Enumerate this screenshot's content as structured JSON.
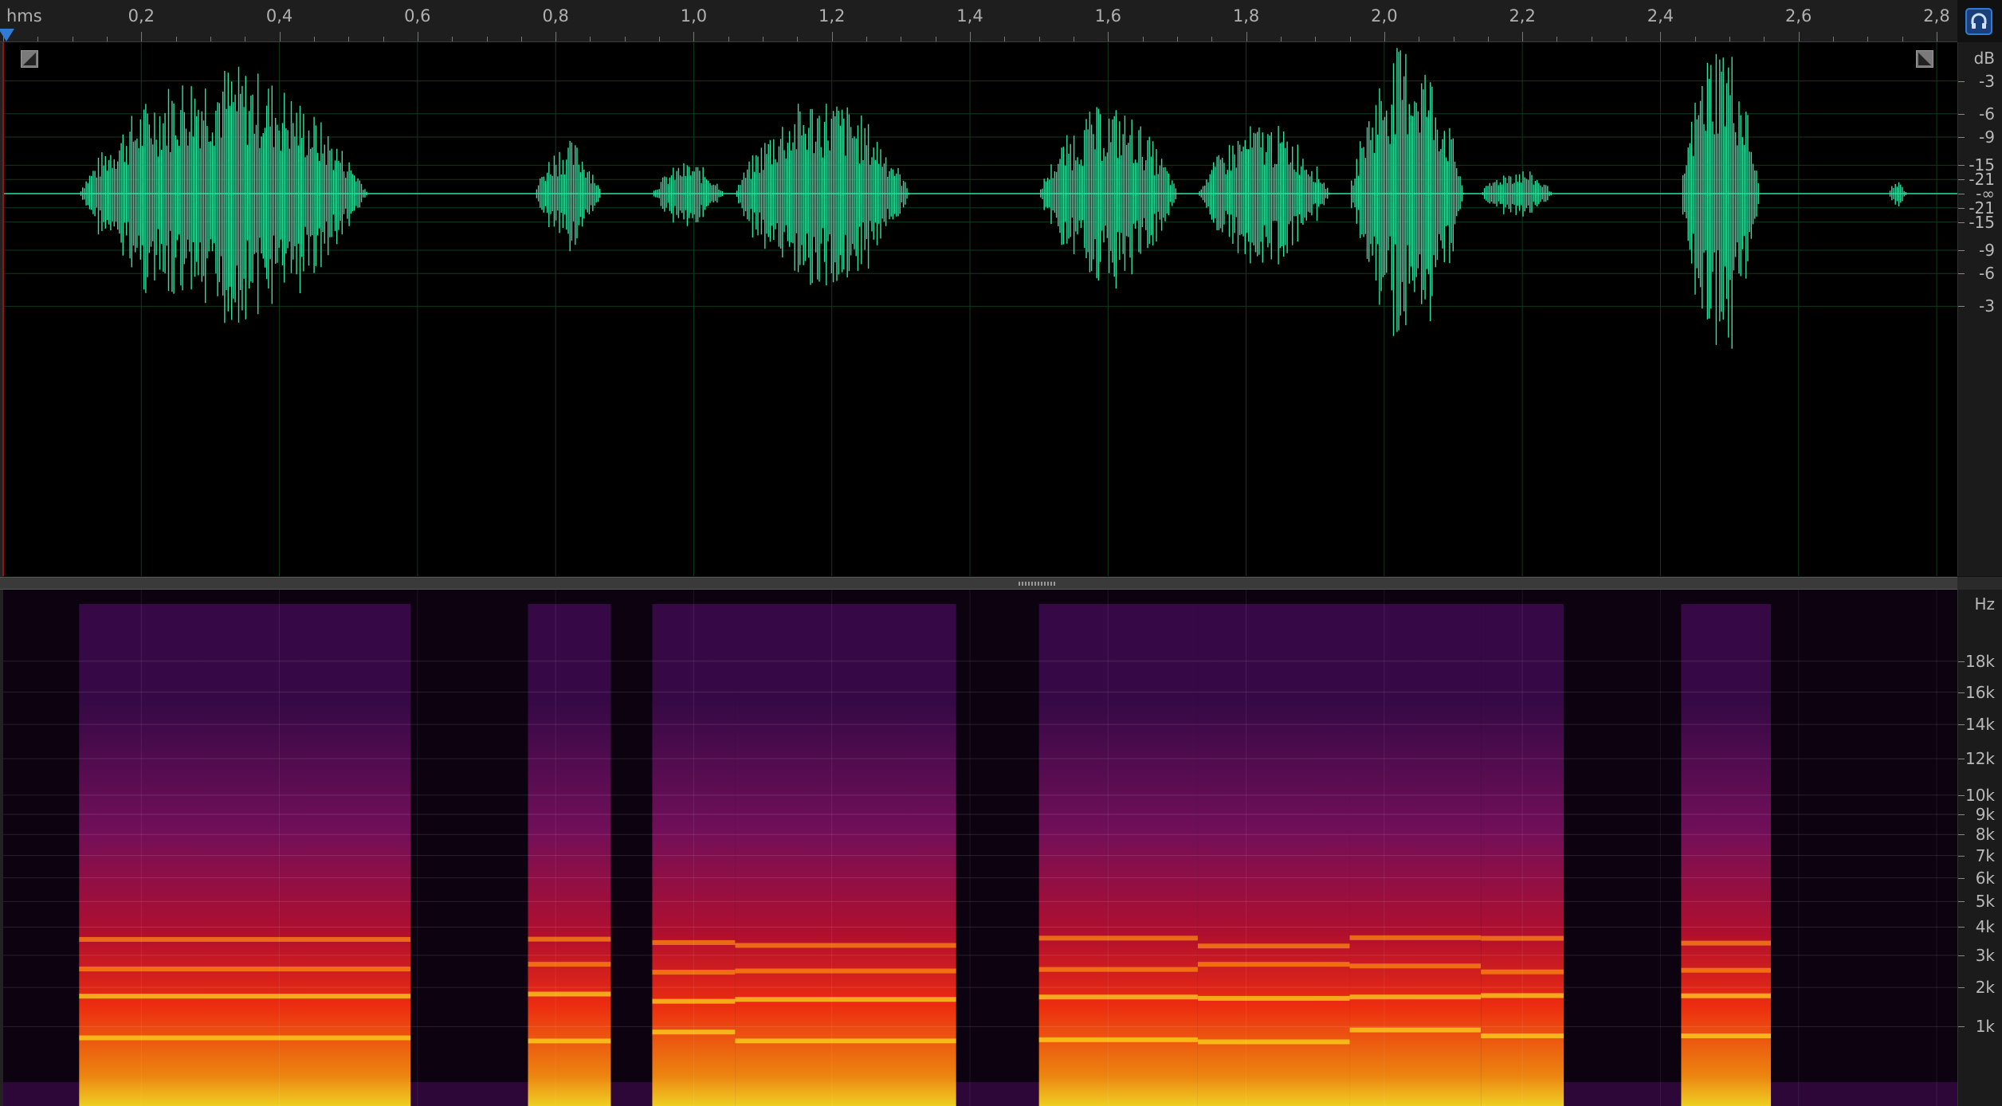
{
  "ruler": {
    "unit": "hms",
    "ticks": [
      "0,2",
      "0,4",
      "0,6",
      "0,8",
      "1,0",
      "1,2",
      "1,4",
      "1,6",
      "1,8",
      "2,0",
      "2,2",
      "2,4",
      "2,6",
      "2,8"
    ],
    "tick_values": [
      0.2,
      0.4,
      0.6,
      0.8,
      1.0,
      1.2,
      1.4,
      1.6,
      1.8,
      2.0,
      2.2,
      2.4,
      2.6,
      2.8
    ],
    "start_seconds": 0,
    "end_seconds": 2.83
  },
  "amplitude_scale": {
    "unit": "dB",
    "labels": [
      "-3",
      "-6",
      "-9",
      "-15",
      "-21",
      "-∞",
      "-21",
      "-15",
      "-9",
      "-6",
      "-3"
    ],
    "label_fractions": [
      0.707,
      0.501,
      0.355,
      0.178,
      0.089,
      0,
      -0.089,
      -0.178,
      -0.355,
      -0.501,
      -0.707
    ]
  },
  "frequency_scale": {
    "unit": "Hz",
    "labels": [
      "18k",
      "16k",
      "14k",
      "12k",
      "10k",
      "9k",
      "8k",
      "7k",
      "6k",
      "5k",
      "4k",
      "3k",
      "2k",
      "1k"
    ],
    "label_hz": [
      18000,
      16000,
      14000,
      12000,
      10000,
      9000,
      8000,
      7000,
      6000,
      5000,
      4000,
      3000,
      2000,
      1000
    ],
    "max_hz": 22050
  },
  "waveform": {
    "color": "#2fe0a0",
    "segments_seconds": [
      {
        "start": 0.11,
        "end": 0.59,
        "peak": 0.82
      },
      {
        "start": 0.77,
        "end": 0.88,
        "peak": 0.34
      },
      {
        "start": 0.94,
        "end": 1.06,
        "peak": 0.2
      },
      {
        "start": 1.06,
        "end": 1.35,
        "peak": 0.62
      },
      {
        "start": 1.5,
        "end": 1.73,
        "peak": 0.56
      },
      {
        "start": 1.73,
        "end": 1.95,
        "peak": 0.45
      },
      {
        "start": 1.95,
        "end": 2.14,
        "peak": 0.95
      },
      {
        "start": 2.14,
        "end": 2.26,
        "peak": 0.16
      },
      {
        "start": 2.43,
        "end": 2.56,
        "peak": 1.0
      },
      {
        "start": 2.73,
        "end": 2.76,
        "peak": 0.08
      }
    ]
  },
  "spectrogram": {
    "colormap": [
      "#0c0210",
      "#3a0a4a",
      "#7a1060",
      "#c01030",
      "#ff3010",
      "#ff9010",
      "#ffe020"
    ],
    "events_seconds": [
      {
        "start": 0.11,
        "end": 0.59
      },
      {
        "start": 0.76,
        "end": 0.88
      },
      {
        "start": 0.94,
        "end": 1.06
      },
      {
        "start": 1.06,
        "end": 1.38
      },
      {
        "start": 1.5,
        "end": 1.73
      },
      {
        "start": 1.73,
        "end": 1.95
      },
      {
        "start": 1.95,
        "end": 2.14
      },
      {
        "start": 2.14,
        "end": 2.26
      },
      {
        "start": 2.43,
        "end": 2.56
      }
    ]
  },
  "colors": {
    "accent": "#2f7bd8",
    "grid": "#0f3a1c",
    "background": "#000000"
  }
}
